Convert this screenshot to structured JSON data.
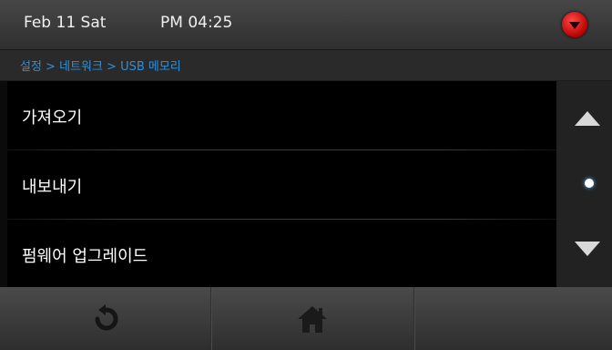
{
  "status_bar": {
    "date": "Feb 11 Sat",
    "time": "PM 04:25",
    "alert_icon": "red-alert-dropdown-icon"
  },
  "breadcrumb": {
    "text": "설정 > 네트워크 > USB 메모리"
  },
  "menu": {
    "items": [
      {
        "label": "가져오기"
      },
      {
        "label": "내보내기"
      },
      {
        "label": "펌웨어 업그레이드"
      }
    ]
  },
  "scroll": {
    "up_icon": "arrow-up-icon",
    "down_icon": "arrow-down-icon"
  },
  "bottom_bar": {
    "buttons": [
      {
        "icon": "back-icon"
      },
      {
        "icon": "home-icon"
      },
      {
        "icon": ""
      }
    ]
  },
  "colors": {
    "breadcrumb": "#2f8fd8",
    "alert": "#d40000",
    "background": "#000000"
  }
}
